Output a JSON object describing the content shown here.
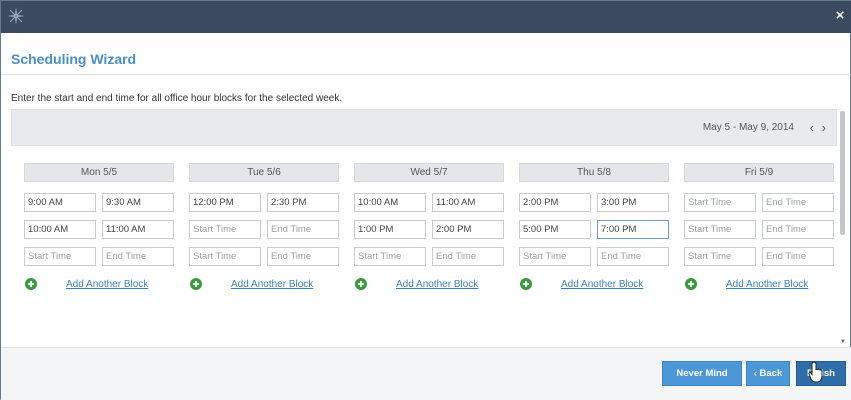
{
  "dialog": {
    "title": "Scheduling Wizard",
    "close_glyph": "×",
    "logo_icon": "star-logo-icon"
  },
  "instructions": "Enter the start and end time for all office hour blocks for the selected week.",
  "week": {
    "range": "May 5 - May 9, 2014",
    "prev_glyph": "‹",
    "next_glyph": "›"
  },
  "placeholders": {
    "start": "Start Time",
    "end": "End Time"
  },
  "days": [
    {
      "label": "Mon 5/5",
      "blocks": [
        {
          "start": "9:00 AM",
          "end": "9:30 AM"
        },
        {
          "start": "10:00 AM",
          "end": "11:00 AM"
        },
        {
          "start": "",
          "end": ""
        }
      ],
      "add_label": "Add Another Block"
    },
    {
      "label": "Tue 5/6",
      "blocks": [
        {
          "start": "12:00 PM",
          "end": "2:30 PM"
        },
        {
          "start": "",
          "end": ""
        },
        {
          "start": "",
          "end": ""
        }
      ],
      "add_label": "Add Another Block"
    },
    {
      "label": "Wed 5/7",
      "blocks": [
        {
          "start": "10:00 AM",
          "end": "11:00 AM"
        },
        {
          "start": "1:00 PM",
          "end": "2:00 PM"
        },
        {
          "start": "",
          "end": ""
        }
      ],
      "add_label": "Add Another Block"
    },
    {
      "label": "Thu 5/8",
      "blocks": [
        {
          "start": "2:00 PM",
          "end": "3:00 PM"
        },
        {
          "start": "5:00 PM",
          "end": "7:00 PM"
        },
        {
          "start": "",
          "end": ""
        }
      ],
      "add_label": "Add Another Block"
    },
    {
      "label": "Fri 5/9",
      "blocks": [
        {
          "start": "",
          "end": ""
        },
        {
          "start": "",
          "end": ""
        },
        {
          "start": "",
          "end": ""
        }
      ],
      "add_label": "Add Another Block"
    }
  ],
  "buttons": {
    "never_mind": "Never Mind",
    "back": "‹ Back",
    "finish": "Finish"
  },
  "colors": {
    "titlebar": "#3b4a5e",
    "title_text": "#4a8fc7",
    "button": "#4c97d8",
    "button_active": "#2f6da8",
    "add_icon": "#3a9a3e",
    "link": "#3d7dbc"
  }
}
